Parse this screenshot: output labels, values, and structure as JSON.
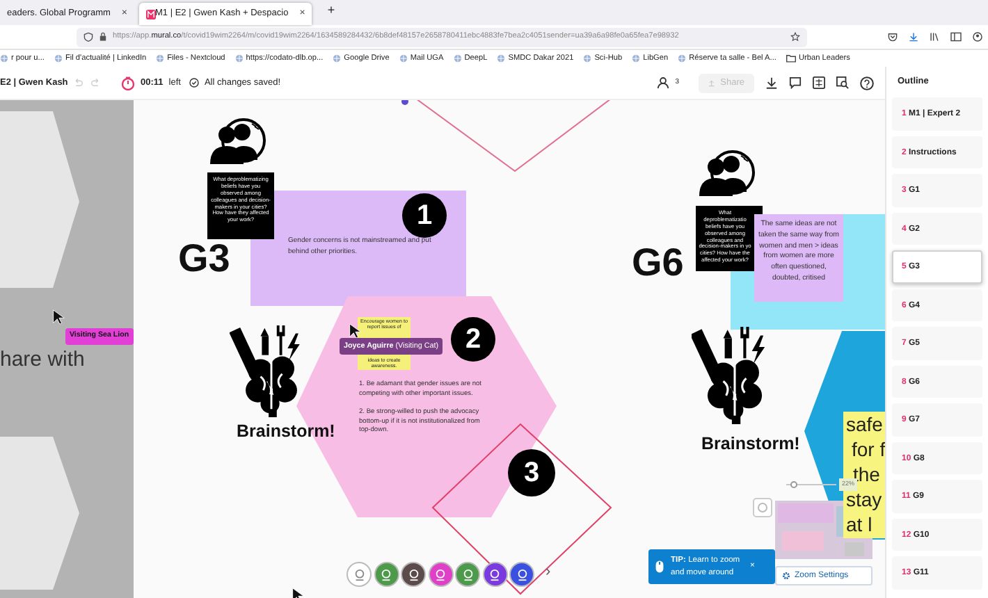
{
  "browser": {
    "tabs": [
      {
        "title": "eaders. Global Programm",
        "close": "×",
        "selected": false
      },
      {
        "title": "M1 | E2 | Gwen Kash + Despacio",
        "close": "×",
        "selected": true
      }
    ],
    "new_tab": "+",
    "url": "https://app.**mural.co**/t/covid19wim2264/m/covid19wim2264/1634589284432/6b8def48157e2658780411ebc4883fe7bea2c4051sender=ua39a6a98fe0a65fea7e98932",
    "bookmarks": [
      {
        "label": "r pour u...",
        "kind": "site"
      },
      {
        "label": "Fil d'actualité | LinkedIn",
        "kind": "site"
      },
      {
        "label": "Files - Nextcloud",
        "kind": "site"
      },
      {
        "label": "https://codato-dlb.op...",
        "kind": "site"
      },
      {
        "label": "Google Drive",
        "kind": "site"
      },
      {
        "label": "Mail UGA",
        "kind": "site"
      },
      {
        "label": "DeepL",
        "kind": "site"
      },
      {
        "label": "SMDC Dakar 2021",
        "kind": "site"
      },
      {
        "label": "Sci-Hub",
        "kind": "site"
      },
      {
        "label": "LibGen",
        "kind": "site"
      },
      {
        "label": "Réserve ta salle - Bel A...",
        "kind": "site"
      },
      {
        "label": "Urban Leaders",
        "kind": "folder"
      }
    ]
  },
  "toolbar": {
    "title": "E2 | Gwen Kash",
    "timer": "00:11",
    "timer_suffix": "left",
    "save_status": "All changes saved!",
    "participants": "3",
    "share": "Share",
    "share_disabled": true
  },
  "canvas": {
    "side_text": "hare with",
    "cursor_labels": [
      {
        "text": "Visiting Sea Lion",
        "color": "#e23fd6"
      },
      {
        "text": "**Joyce Aguirre** (Visiting Cat)",
        "color": "#7b3f86"
      }
    ],
    "boards": [
      {
        "title": "G3",
        "question": "What deproblematizing beliefs have you observed among colleagues and decision-makers in your cities? How have they affected your work?",
        "brainstorm": "Brainstorm!",
        "note": "Gender concerns is not mainstreamed and put behind other priorities.",
        "markers": [
          "1",
          "2",
          "3"
        ],
        "small_note": [
          "Encourage women to report issues of",
          "ideas to create awareness."
        ],
        "steps": [
          "1. Be adamant that gender issues are not competing with other important issues.",
          "2. Be strong-willed to push the advocacy bottom-up if it is not institutionalized from top-down."
        ]
      },
      {
        "title": "G6",
        "question": "What deproblematizatio beliefs have you observed among colleagues and decision-makers in yo cities? How have the affected your work?",
        "brainstorm": "Brainstorm!",
        "note": "The same ideas are not taken the same way from women and men > ideas from women are more often questioned, doubted, critised",
        "big_note": [
          "safe",
          "for f",
          "the",
          "stay",
          "at l"
        ]
      }
    ],
    "avatars": [
      {
        "color": "#ffffff"
      },
      {
        "color": "#4d9a4a"
      },
      {
        "color": "#5b4b4b"
      },
      {
        "color": "#e040c8"
      },
      {
        "color": "#4d9a4a"
      },
      {
        "color": "#7a3ae0"
      },
      {
        "color": "#3a50e0"
      }
    ],
    "more": "›"
  },
  "zoom": {
    "level": 0.15,
    "reading": "22%",
    "tip": "**TIP:** Learn to zoom and move around",
    "close": "×",
    "settings": "Zoom Settings"
  },
  "outline": {
    "title": "Outline",
    "items": [
      {
        "number": "1",
        "label": "M1 | Expert 2",
        "selected": false
      },
      {
        "number": "2",
        "label": "Instructions",
        "selected": false
      },
      {
        "number": "3",
        "label": "G1",
        "selected": false
      },
      {
        "number": "4",
        "label": "G2",
        "selected": false
      },
      {
        "number": "5",
        "label": "G3",
        "selected": true
      },
      {
        "number": "6",
        "label": "G4",
        "selected": false
      },
      {
        "number": "7",
        "label": "G5",
        "selected": false
      },
      {
        "number": "8",
        "label": "G6",
        "selected": false
      },
      {
        "number": "9",
        "label": "G7",
        "selected": false
      },
      {
        "number": "10",
        "label": "G8",
        "selected": false
      },
      {
        "number": "11",
        "label": "G9",
        "selected": false
      },
      {
        "number": "12",
        "label": "G10",
        "selected": false
      },
      {
        "number": "13",
        "label": "G11",
        "selected": false
      }
    ]
  }
}
